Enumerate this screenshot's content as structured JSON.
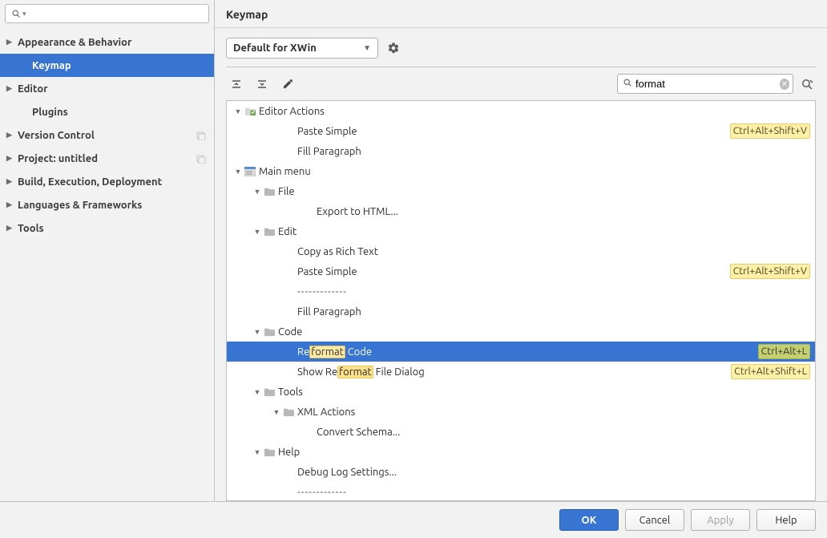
{
  "header": {
    "title": "Keymap"
  },
  "sidebar": {
    "search_value": "",
    "items": [
      {
        "label": "Appearance & Behavior",
        "type": "parent"
      },
      {
        "label": "Keymap",
        "type": "child",
        "selected": true
      },
      {
        "label": "Editor",
        "type": "parent"
      },
      {
        "label": "Plugins",
        "type": "child"
      },
      {
        "label": "Version Control",
        "type": "parent",
        "badge": true
      },
      {
        "label": "Project: untitled",
        "type": "parent",
        "badge": true
      },
      {
        "label": "Build, Execution, Deployment",
        "type": "parent"
      },
      {
        "label": "Languages & Frameworks",
        "type": "parent"
      },
      {
        "label": "Tools",
        "type": "parent"
      }
    ]
  },
  "scheme": {
    "selected": "Default for XWin"
  },
  "search": {
    "value": "format"
  },
  "tree": [
    {
      "d": 0,
      "arrow": "v",
      "icon": "editor",
      "label": "Editor Actions"
    },
    {
      "d": 2,
      "label": "Paste Simple",
      "shortcut": "Ctrl+Alt+Shift+V"
    },
    {
      "d": 2,
      "label": "Fill Paragraph"
    },
    {
      "d": 0,
      "arrow": "v",
      "icon": "menu",
      "label": "Main menu"
    },
    {
      "d": 1,
      "arrow": "v",
      "icon": "folder",
      "label": "File"
    },
    {
      "d": 3,
      "label": "Export to HTML..."
    },
    {
      "d": 1,
      "arrow": "v",
      "icon": "folder",
      "label": "Edit"
    },
    {
      "d": 2,
      "label": "Copy as Rich Text"
    },
    {
      "d": 2,
      "label": "Paste Simple",
      "shortcut": "Ctrl+Alt+Shift+V"
    },
    {
      "d": 2,
      "label": "-------------",
      "sep": true
    },
    {
      "d": 2,
      "label": "Fill Paragraph"
    },
    {
      "d": 1,
      "arrow": "v",
      "icon": "folder",
      "label": "Code"
    },
    {
      "d": 2,
      "pre": "Re",
      "hl": "format",
      "post": " Code",
      "shortcut": "Ctrl+Alt+L",
      "selected": true
    },
    {
      "d": 2,
      "pre": "Show Re",
      "hl": "format",
      "post": " File Dialog",
      "shortcut": "Ctrl+Alt+Shift+L"
    },
    {
      "d": 1,
      "arrow": "v",
      "icon": "folder",
      "label": "Tools"
    },
    {
      "d": 2,
      "arrow": "v",
      "icon": "folder",
      "label": "XML Actions"
    },
    {
      "d": 3,
      "label": "Convert Schema..."
    },
    {
      "d": 1,
      "arrow": "v",
      "icon": "folder",
      "label": "Help"
    },
    {
      "d": 2,
      "label": "Debug Log Settings..."
    },
    {
      "d": 2,
      "label": "-------------",
      "sep": true
    }
  ],
  "buttons": {
    "ok": "OK",
    "cancel": "Cancel",
    "apply": "Apply",
    "help": "Help"
  }
}
